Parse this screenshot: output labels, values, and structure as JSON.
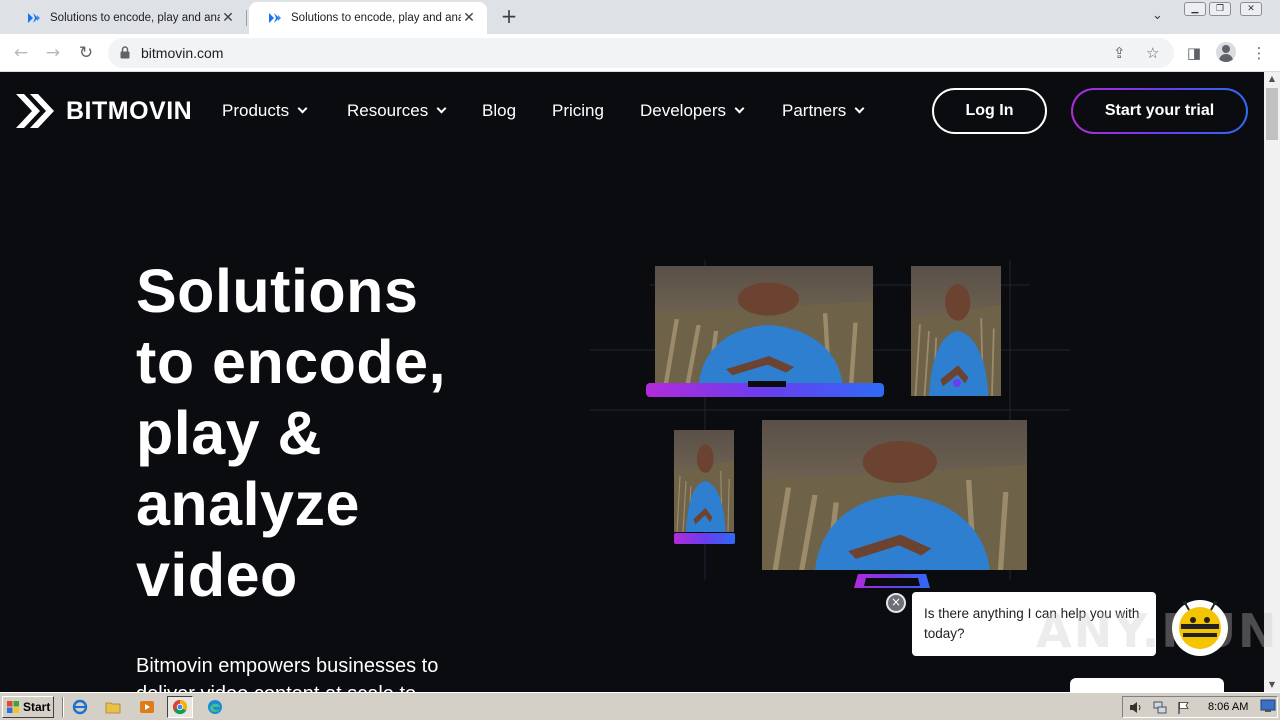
{
  "browser": {
    "tabs": [
      {
        "title": "Solutions to encode, play and analyze video",
        "active": false
      },
      {
        "title": "Solutions to encode, play and analyze video",
        "active": true
      }
    ],
    "new_tab_label": "+",
    "url": "bitmovin.com"
  },
  "site": {
    "logo_text": "BITMOVIN",
    "nav": [
      {
        "label": "Products",
        "has_dropdown": true
      },
      {
        "label": "Resources",
        "has_dropdown": true
      },
      {
        "label": "Blog",
        "has_dropdown": false
      },
      {
        "label": "Pricing",
        "has_dropdown": false
      },
      {
        "label": "Developers",
        "has_dropdown": true
      },
      {
        "label": "Partners",
        "has_dropdown": true
      }
    ],
    "login_label": "Log In",
    "trial_label": "Start your trial"
  },
  "hero": {
    "title_lines": [
      "Solutions",
      "to encode,",
      "play &",
      "analyze",
      "video"
    ],
    "description": "Bitmovin empowers businesses to",
    "description_cont": "deliver video content at scale to"
  },
  "chat": {
    "message": "Is there anything I can help you with today?",
    "close_label": "×"
  },
  "watermark": "ANY.RUN",
  "taskbar": {
    "start_label": "Start",
    "clock": "8:06 AM"
  },
  "colors": {
    "page_bg": "#0b0c10",
    "accent_purple": "#b32bd9",
    "accent_blue": "#2e6bf5",
    "tab_bar": "#dee1e6",
    "taskbar": "#d4d0c8"
  }
}
